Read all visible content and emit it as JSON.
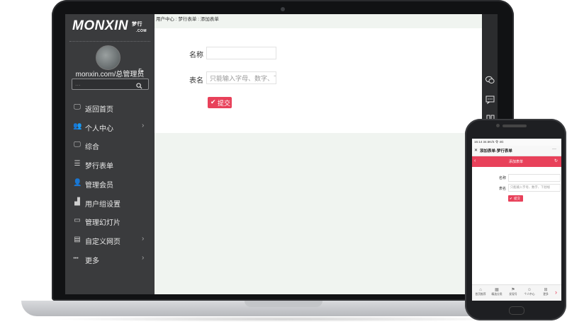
{
  "sidebar": {
    "logo_text": "MONXIN",
    "logo_sub": "梦行",
    "logo_com": ".COM",
    "username": "monxin.com/总管理员",
    "search_placeholder": "...",
    "items": [
      {
        "label": "返回首页",
        "icon": "monitor-icon",
        "arrow": false
      },
      {
        "label": "个人中心",
        "icon": "users-icon",
        "arrow": true
      },
      {
        "label": "综合",
        "icon": "monitor-icon",
        "arrow": false
      },
      {
        "label": "梦行表单",
        "icon": "list-icon",
        "arrow": false
      },
      {
        "label": "管理会员",
        "icon": "user-icon",
        "arrow": false
      },
      {
        "label": "用户组设置",
        "icon": "group-icon",
        "arrow": false
      },
      {
        "label": "管理幻灯片",
        "icon": "slides-icon",
        "arrow": false
      },
      {
        "label": "自定义网页",
        "icon": "webpage-icon",
        "arrow": true
      },
      {
        "label": "更多",
        "icon": "more-dots-icon",
        "arrow": true
      }
    ]
  },
  "breadcrumb": "用户中心 : 梦行表单 : 添加表单",
  "form": {
    "name_label": "名称",
    "name_value": "",
    "table_label": "表名",
    "table_placeholder": "只能输入字母、数字、下划",
    "submit_label": "提交"
  },
  "phone": {
    "status_time": "16:14 34.5K/S 令 4G",
    "title": "添加表单-梦行表单",
    "close": "✕",
    "more": "···",
    "redbar_title": "添加表单",
    "name_label": "名称",
    "table_label": "表名",
    "table_placeholder": "只能输入字母、数字、下划线",
    "submit_label": "提交",
    "tabs": [
      "首页推荐",
      "精选分类",
      "发现号",
      "个人中心",
      "更多"
    ]
  },
  "colors": {
    "accent": "#e8415a",
    "sidebar_bg": "#3a3b3d",
    "content_bg": "#f0f4f0"
  }
}
